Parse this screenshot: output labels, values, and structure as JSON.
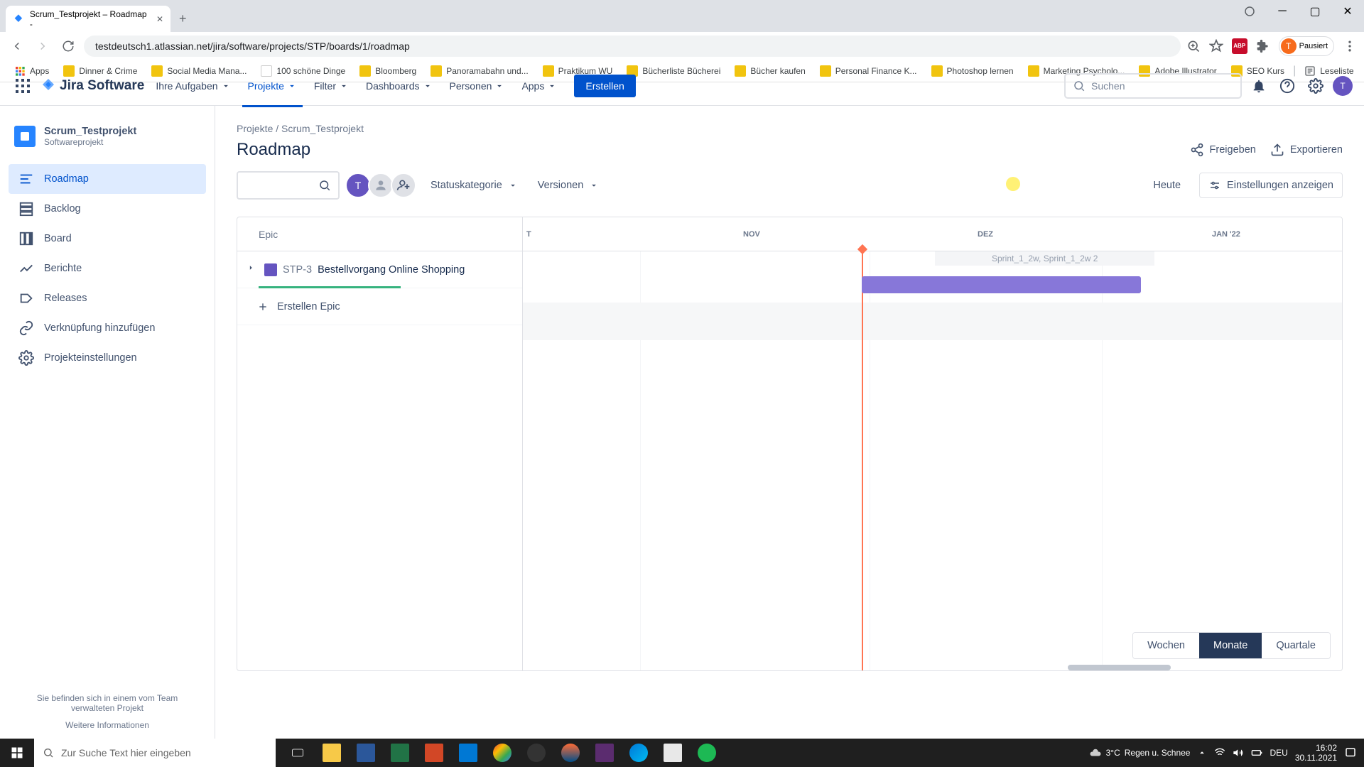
{
  "browser": {
    "tab_title": "Scrum_Testprojekt – Roadmap - ",
    "url": "testdeutsch1.atlassian.net/jira/software/projects/STP/boards/1/roadmap",
    "profile_status": "Pausiert",
    "bookmarks": [
      "Apps",
      "Dinner & Crime",
      "Social Media Mana...",
      "100 schöne Dinge",
      "Bloomberg",
      "Panoramabahn und...",
      "Praktikum WU",
      "Bücherliste Bücherei",
      "Bücher kaufen",
      "Personal Finance K...",
      "Photoshop lernen",
      "Marketing Psycholo...",
      "Adobe Illustrator",
      "SEO Kurs"
    ],
    "bookmark_end": "Leseliste"
  },
  "jira": {
    "logo": "Jira Software",
    "nav": [
      "Ihre Aufgaben",
      "Projekte",
      "Filter",
      "Dashboards",
      "Personen",
      "Apps"
    ],
    "create": "Erstellen",
    "search_placeholder": "Suchen"
  },
  "sidebar": {
    "project_name": "Scrum_Testprojekt",
    "project_type": "Softwareprojekt",
    "items": [
      "Roadmap",
      "Backlog",
      "Board",
      "Berichte",
      "Releases",
      "Verknüpfung hinzufügen",
      "Projekteinstellungen"
    ],
    "footer_text": "Sie befinden sich in einem vom Team verwalteten Projekt",
    "footer_link": "Weitere Informationen"
  },
  "page": {
    "breadcrumb_1": "Projekte",
    "breadcrumb_2": "Scrum_Testprojekt",
    "title": "Roadmap",
    "share": "Freigeben",
    "export": "Exportieren"
  },
  "toolbar": {
    "avatar_letter": "T",
    "status_filter": "Statuskategorie",
    "version_filter": "Versionen",
    "today": "Heute",
    "show_settings": "Einstellungen anzeigen"
  },
  "roadmap": {
    "epic_header": "Epic",
    "months": [
      "T",
      "NOV",
      "DEZ",
      "JAN '22"
    ],
    "sprint_label": "Sprint_1_2w, Sprint_1_2w 2",
    "epic_key": "STP-3",
    "epic_title": "Bestellvorgang Online Shopping",
    "create_epic": "Erstellen Epic",
    "zoom": [
      "Wochen",
      "Monate",
      "Quartale"
    ]
  },
  "taskbar": {
    "search_placeholder": "Zur Suche Text hier eingeben",
    "weather_temp": "3°C",
    "weather_text": "Regen u. Schnee",
    "lang": "DEU",
    "time": "16:02",
    "date": "30.11.2021"
  }
}
